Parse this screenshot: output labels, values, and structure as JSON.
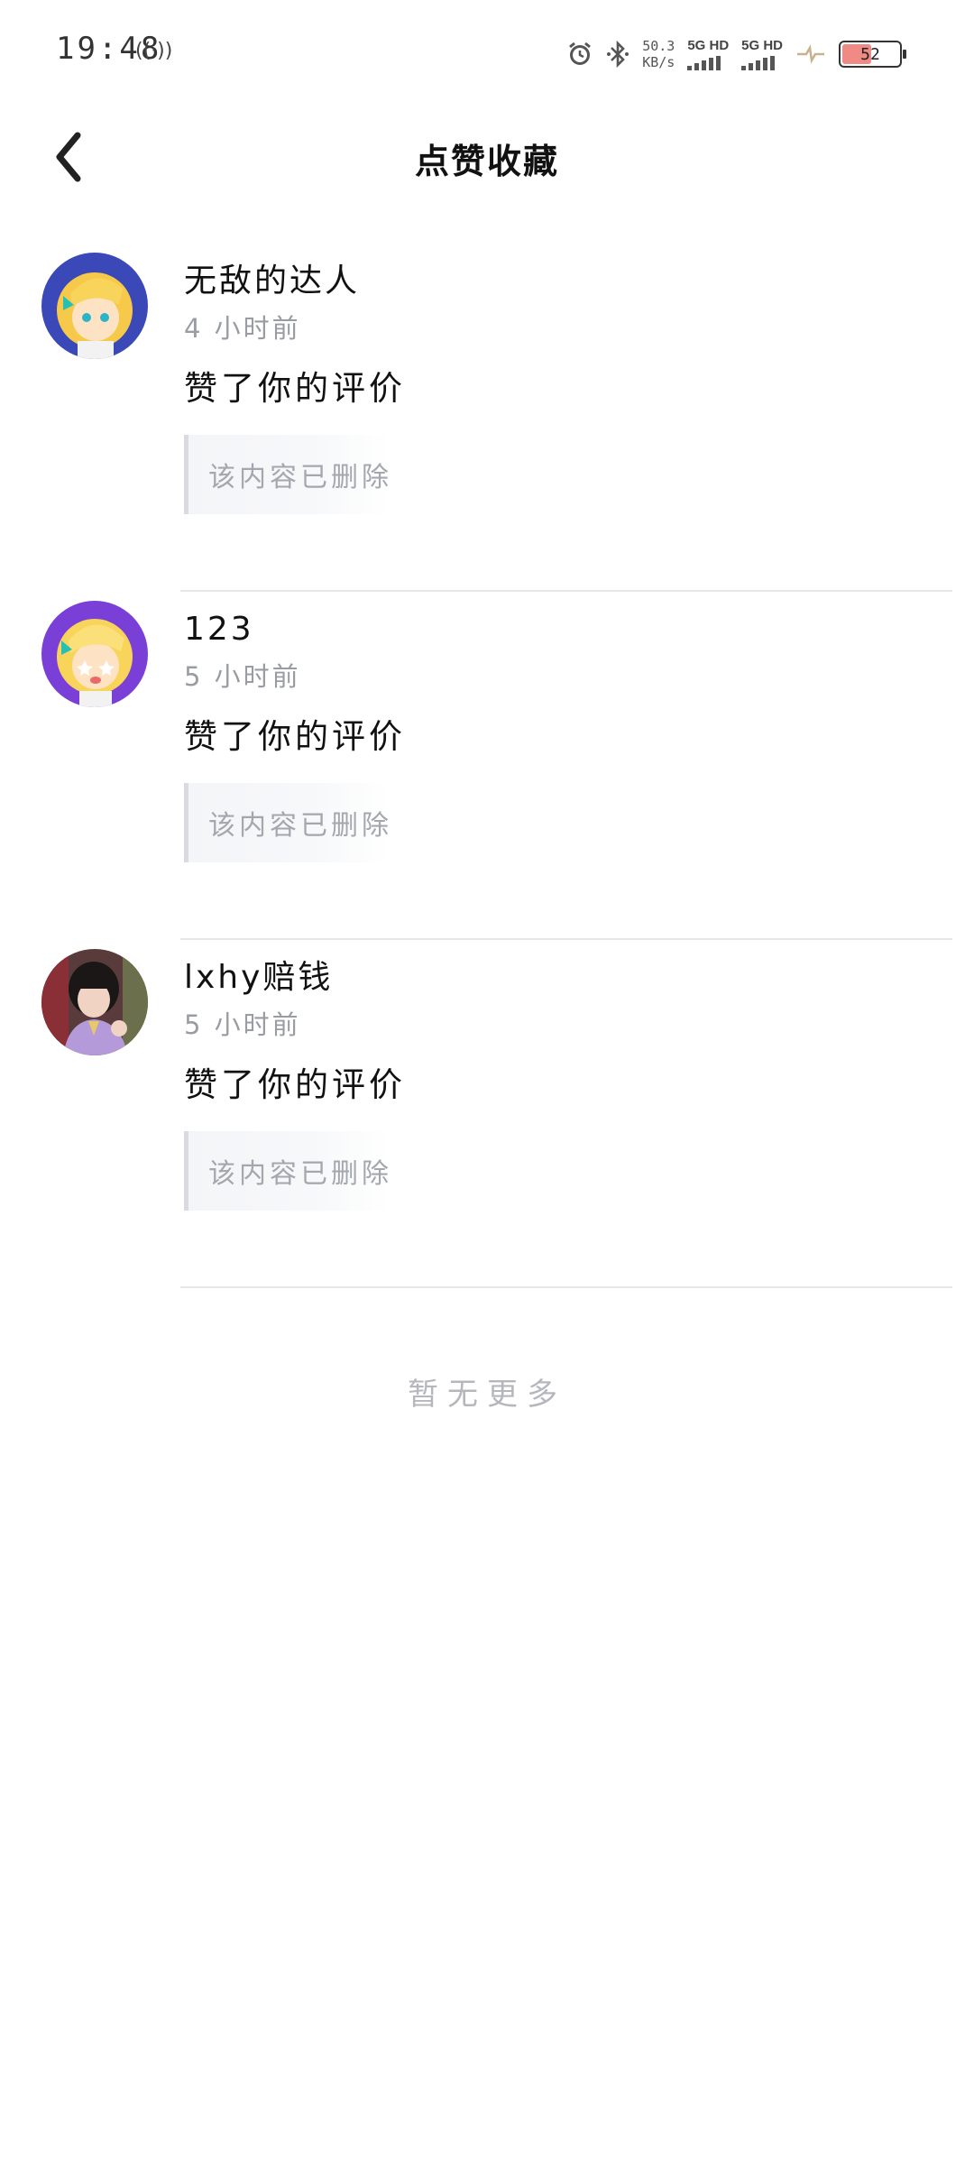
{
  "status_bar": {
    "time": "19:48",
    "hotspot_icon": "hotspot-icon",
    "alarm_icon": "alarm-icon",
    "bluetooth_icon": "bluetooth-icon",
    "speed_value": "50.3",
    "speed_unit": "KB/s",
    "sim1_label": "5G HD",
    "sim2_label": "5G HD",
    "battery_level": "52",
    "battery_color": "#f08a84"
  },
  "header": {
    "title": "点赞收藏",
    "back_icon": "back-arrow-icon"
  },
  "items": [
    {
      "user": "无敌的达人",
      "time": "4 小时前",
      "action": "赞了你的评价",
      "quote": "该内容已删除",
      "avatar_bg": "#3a48b8"
    },
    {
      "user": "123",
      "time": "5 小时前",
      "action": "赞了你的评价",
      "quote": "该内容已删除",
      "avatar_bg": "#7a3fd6"
    },
    {
      "user": "lxhy赔钱",
      "time": "5 小时前",
      "action": "赞了你的评价",
      "quote": "该内容已删除",
      "avatar_bg": "#5a3b3b"
    }
  ],
  "footer": {
    "no_more": "暂无更多"
  }
}
